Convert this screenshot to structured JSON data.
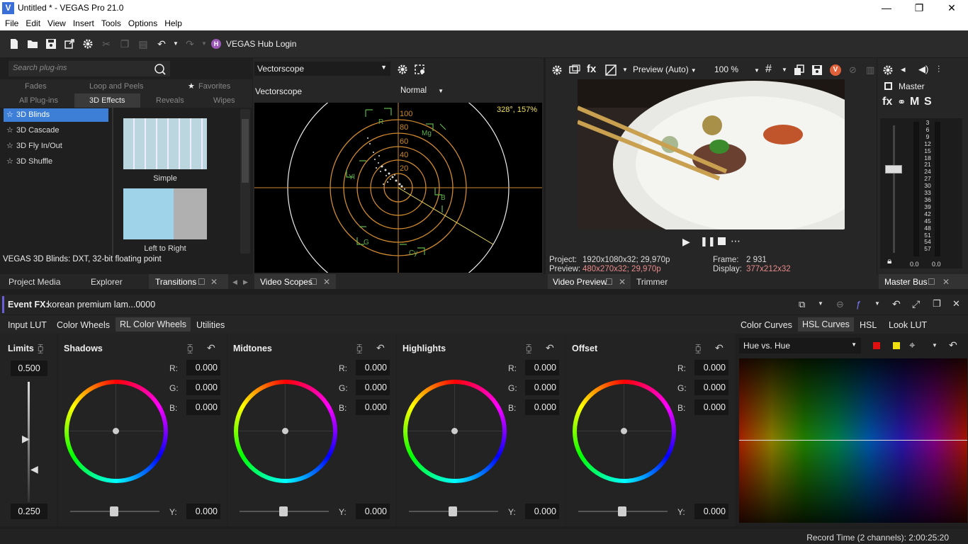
{
  "window": {
    "title": "Untitled * - VEGAS Pro 21.0",
    "logo_letter": "V",
    "controls": {
      "minimize": "—",
      "maximize": "❐",
      "close": "✕"
    }
  },
  "menu": [
    "File",
    "Edit",
    "View",
    "Insert",
    "Tools",
    "Options",
    "Help"
  ],
  "toolbar": {
    "hub_label": "VEGAS Hub Login",
    "hub_logo": "H"
  },
  "plugins": {
    "search_placeholder": "Search plug-ins",
    "categories_row1": [
      "Fades",
      "Loop and Peels",
      "Favorites"
    ],
    "categories_row2": [
      "All Plug-ins",
      "3D Effects",
      "Reveals",
      "Wipes"
    ],
    "active_category": "3D Effects",
    "items": [
      "3D Blinds",
      "3D Cascade",
      "3D Fly In/Out",
      "3D Shuffle"
    ],
    "selected_item": "3D Blinds",
    "presets": [
      "Simple",
      "Left to Right"
    ],
    "status": "VEGAS 3D Blinds: DXT, 32-bit floating point"
  },
  "scope": {
    "type_select": "Vectorscope",
    "label": "Vectorscope",
    "mode": "Normal",
    "readout": "328°, 157%",
    "ring_labels": [
      "100",
      "80",
      "60",
      "40",
      "20"
    ],
    "targets": [
      "R",
      "Mg",
      "B",
      "Cy",
      "G",
      "Yl"
    ]
  },
  "preview": {
    "mode": "Preview (Auto)",
    "zoom": "100 %",
    "project_label": "Project:",
    "project_value": "1920x1080x32; 29,970p",
    "preview_label": "Preview:",
    "preview_value": "480x270x32; 29,970p",
    "frame_label": "Frame:",
    "frame_value": "2 931",
    "display_label": "Display:",
    "display_value": "377x212x32"
  },
  "master": {
    "label": "Master",
    "buttons": [
      "fx",
      "M",
      "S"
    ],
    "scale": [
      "3",
      "6",
      "9",
      "12",
      "15",
      "18",
      "21",
      "24",
      "27",
      "30",
      "33",
      "36",
      "39",
      "42",
      "45",
      "48",
      "51",
      "54",
      "57"
    ],
    "left_value": "0.0",
    "right_value": "0.0"
  },
  "dock_tabs": {
    "project_media": "Project Media",
    "explorer": "Explorer",
    "transitions": "Transitions",
    "video_scopes": "Video Scopes",
    "video_preview": "Video Preview",
    "trimmer": "Trimmer",
    "master_bus": "Master Bus"
  },
  "event_fx": {
    "label": "Event FX:",
    "clip": "korean premium lam...0000",
    "tabs_left": [
      "Input LUT",
      "Color Wheels",
      "RL Color Wheels",
      "Utilities"
    ],
    "active_left": "RL Color Wheels",
    "tabs_right": [
      "Color Curves",
      "HSL Curves",
      "HSL",
      "Look LUT"
    ],
    "active_right": "HSL Curves"
  },
  "limits": {
    "title": "Limits",
    "top": "0.500",
    "bottom": "0.250"
  },
  "wheels": [
    {
      "title": "Shadows",
      "r": "0.000",
      "g": "0.000",
      "b": "0.000",
      "y": "0.000"
    },
    {
      "title": "Midtones",
      "r": "0.000",
      "g": "0.000",
      "b": "0.000",
      "y": "0.000"
    },
    {
      "title": "Highlights",
      "r": "0.000",
      "g": "0.000",
      "b": "0.000",
      "y": "0.000"
    },
    {
      "title": "Offset",
      "r": "0.000",
      "g": "0.000",
      "b": "0.000",
      "y": "0.000"
    }
  ],
  "channel_labels": {
    "r": "R:",
    "g": "G:",
    "b": "B:",
    "y": "Y:"
  },
  "hsl": {
    "mode": "Hue vs. Hue"
  },
  "status": {
    "record_time": "Record Time (2 channels): 2:00:25:20"
  }
}
